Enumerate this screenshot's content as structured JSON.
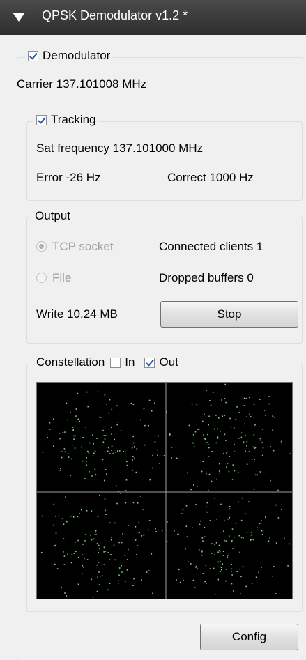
{
  "title": "QPSK Demodulator v1.2 *",
  "demodulator": {
    "label": "Demodulator",
    "checked": true,
    "carrier": "Carrier 137.101008 MHz"
  },
  "tracking": {
    "label": "Tracking",
    "checked": true,
    "sat_frequency": "Sat frequency 137.101000 MHz",
    "error": "Error -26 Hz",
    "correct": "Correct 1000 Hz"
  },
  "output": {
    "label": "Output",
    "tcp_socket": "TCP socket",
    "tcp_selected": true,
    "file": "File",
    "connected_clients": "Connected clients 1",
    "dropped_buffers": "Dropped buffers 0",
    "write": "Write 10.24 MB",
    "stop_button": "Stop"
  },
  "constellation": {
    "label": "Constellation",
    "in_label": "In",
    "in_checked": false,
    "out_label": "Out",
    "out_checked": true,
    "dot_color": "#7ed17e",
    "axis_color": "#a0a0a0"
  },
  "config_button": "Config",
  "colors": {
    "titlebar": "#3a3a3a",
    "panel": "#f0f0f0"
  }
}
